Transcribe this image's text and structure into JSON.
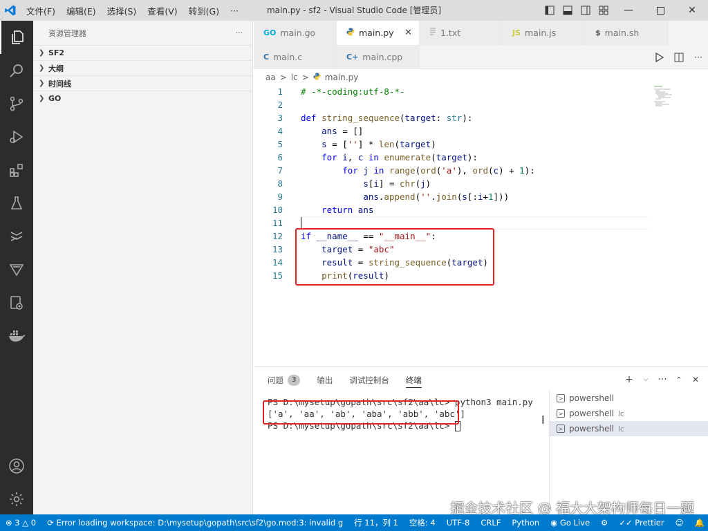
{
  "window": {
    "title": "main.py - sf2 - Visual Studio Code [管理员]"
  },
  "menu": [
    "文件(F)",
    "编辑(E)",
    "选择(S)",
    "查看(V)",
    "转到(G)",
    "···"
  ],
  "sidebar": {
    "title": "资源管理器",
    "more": "···",
    "sections": [
      "SF2",
      "大纲",
      "时间线",
      "GO"
    ]
  },
  "tabs_row1": [
    {
      "label": "main.go",
      "icon": "GO",
      "icon_color": "#00acd7"
    },
    {
      "label": "main.py",
      "icon": "py",
      "icon_color": "#3572a5",
      "active": true
    },
    {
      "label": "1.txt",
      "icon": "txt",
      "icon_color": "#999999"
    },
    {
      "label": "main.js",
      "icon": "JS",
      "icon_color": "#cbcb41"
    },
    {
      "label": "main.sh",
      "icon": "$",
      "icon_color": "#4d5a5e"
    }
  ],
  "tabs_row2": [
    {
      "label": "main.c",
      "icon": "C",
      "icon_color": "#3572a5"
    },
    {
      "label": "main.cpp",
      "icon": "C+",
      "icon_color": "#3572a5"
    }
  ],
  "breadcrumb": [
    "aa",
    ">",
    "lc",
    ">",
    "main.py"
  ],
  "editor": {
    "line_numbers": [
      "1",
      "2",
      "3",
      "4",
      "5",
      "6",
      "7",
      "8",
      "9",
      "10",
      "11",
      "12",
      "13",
      "14",
      "15"
    ]
  },
  "panel": {
    "tabs": [
      "问题",
      "输出",
      "调试控制台",
      "终端"
    ],
    "problems_count": "3",
    "terminal_lines": [
      "PS D:\\mysetup\\gopath\\src\\sf2\\aa\\lc> python3 main.py",
      "['a', 'aa', 'ab', 'aba', 'abb', 'abc']",
      "PS D:\\mysetup\\gopath\\src\\sf2\\aa\\lc> "
    ],
    "terminals": [
      {
        "name": "powershell",
        "sub": ""
      },
      {
        "name": "powershell",
        "sub": "lc"
      },
      {
        "name": "powershell",
        "sub": "lc",
        "selected": true
      }
    ]
  },
  "watermark": "掘金技术社区 @ 福大大架构师每日一题",
  "statusbar": {
    "errors": "3",
    "warnings": "0",
    "message": "Error loading workspace: D:\\mysetup\\gopath\\src\\sf2\\go.mod:3: invalid g",
    "position": "行 11，列 1",
    "spaces": "空格: 4",
    "encoding": "UTF-8",
    "eol": "CRLF",
    "language": "Python",
    "golive": "Go Live",
    "prettier": "Prettier"
  }
}
